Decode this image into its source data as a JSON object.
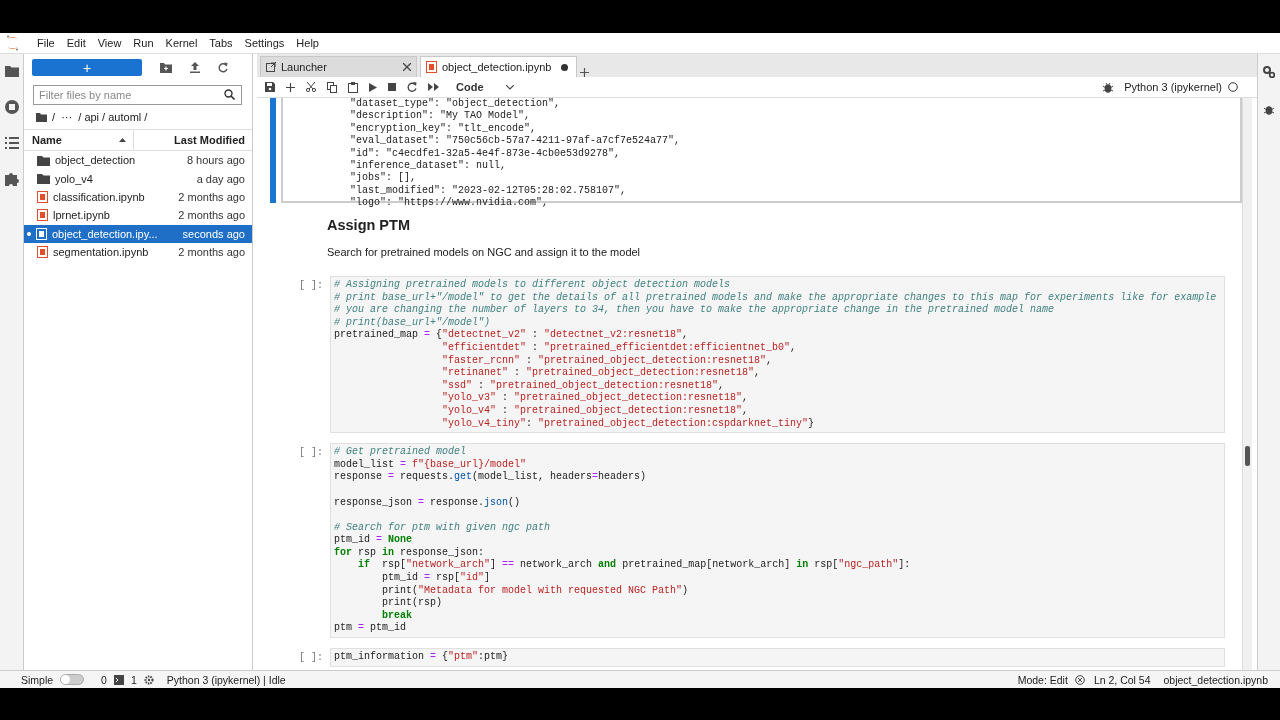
{
  "menu": [
    "File",
    "Edit",
    "View",
    "Run",
    "Kernel",
    "Tabs",
    "Settings",
    "Help"
  ],
  "file_browser": {
    "new_button": "+",
    "filter": {
      "placeholder": "Filter files by name"
    },
    "breadcrumb": "/  ···  / api / automl /",
    "columns": [
      "Name",
      "Last Modified"
    ],
    "files": [
      {
        "name": "object_detection",
        "modified": "8 hours ago",
        "kind": "folder",
        "selected": false,
        "running": false
      },
      {
        "name": "yolo_v4",
        "modified": "a day ago",
        "kind": "folder",
        "selected": false,
        "running": false
      },
      {
        "name": "classification.ipynb",
        "modified": "2 months ago",
        "kind": "notebook",
        "selected": false,
        "running": false
      },
      {
        "name": "lprnet.ipynb",
        "modified": "2 months ago",
        "kind": "notebook",
        "selected": false,
        "running": false
      },
      {
        "name": "object_detection.ipy...",
        "modified": "seconds ago",
        "kind": "notebook",
        "selected": true,
        "running": true
      },
      {
        "name": "segmentation.ipynb",
        "modified": "2 months ago",
        "kind": "notebook",
        "selected": false,
        "running": false
      }
    ]
  },
  "tabs": [
    {
      "label": "Launcher",
      "kind": "launcher",
      "selected": false,
      "modified": false
    },
    {
      "label": "object_detection.ipynb",
      "kind": "notebook",
      "selected": true,
      "modified": true
    }
  ],
  "toolbar": {
    "cell_type": "Code",
    "kernel": "Python 3 (ipykernel)"
  },
  "cells": [
    {
      "kind": "output",
      "active": true,
      "lines": [
        "\"dataset_type\": \"object_detection\",",
        "\"description\": \"My TAO Model\",",
        "\"encryption_key\": \"tlt_encode\",",
        "\"eval_dataset\": \"750c56cb-57a7-4211-97af-a7cf7e524a77\",",
        "\"id\": \"c4ecdfe1-32a5-4e4f-873e-4cb0e53d9278\",",
        "\"inference_dataset\": null,",
        "\"jobs\": [],",
        "\"last_modified\": \"2023-02-12T05:28:02.758107\",",
        "\"logo\": \"https://www.nvidia.com\","
      ]
    },
    {
      "kind": "markdown",
      "active": false,
      "heading": "Assign PTM",
      "text": "Search for pretrained models on NGC and assign it to the model"
    },
    {
      "kind": "code",
      "active": false,
      "prompt": "[ ]:",
      "blocks": [
        [
          "# Assigning pretrained models to different object detection models",
          "# print base_url+\"/model\" to get the details of all pretrained models and make the appropriate changes to this map for experiments like for example",
          "# you are changing the number of layers to 34, then you have to make the appropriate change in the pretrained model name",
          "# print(base_url+\"/model\")",
          "pretrained_map = {\"detectnet_v2\" : \"detectnet_v2:resnet18\",",
          "                  \"efficientdet\" : \"pretrained_efficientdet:efficientnet_b0\",",
          "                  \"faster_rcnn\" : \"pretrained_object_detection:resnet18\",",
          "                  \"retinanet\" : \"pretrained_object_detection:resnet18\",",
          "                  \"ssd\" : \"pretrained_object_detection:resnet18\",",
          "                  \"yolo_v3\" : \"pretrained_object_detection:resnet18\",",
          "                  \"yolo_v4\" : \"pretrained_object_detection:resnet18\",",
          "                  \"yolo_v4_tiny\": \"pretrained_object_detection:cspdarknet_tiny\"}"
        ]
      ]
    },
    {
      "kind": "code",
      "active": false,
      "prompt": "[ ]:",
      "blocks": [
        [
          "# Get pretrained model",
          "model_list = f\"{base_url}/model\"",
          "response = requests.get(model_list, headers=headers)"
        ],
        [
          "response_json = response.json()"
        ],
        [
          "# Search for ptm with given ngc path",
          "ptm_id = None",
          "for rsp in response_json:",
          "    if  rsp[\"network_arch\"] == network_arch and pretrained_map[network_arch] in rsp[\"ngc_path\"]:",
          "        ptm_id = rsp[\"id\"]",
          "        print(\"Metadata for model with requested NGC Path\")",
          "        print(rsp)",
          "        break",
          "ptm = ptm_id"
        ]
      ]
    },
    {
      "kind": "code",
      "active": false,
      "prompt": "[ ]:",
      "blocks": [
        [
          "ptm_information = {\"ptm\":ptm}"
        ]
      ]
    }
  ],
  "status_bar": {
    "mode_toggle": {
      "label": "Simple",
      "on": false
    },
    "terminals": "0",
    "kernels": "1",
    "kernel_status": "Python 3 (ipykernel) | Idle",
    "mode": "Mode: Edit",
    "position": "Ln 2, Col 54",
    "file": "object_detection.ipynb"
  }
}
